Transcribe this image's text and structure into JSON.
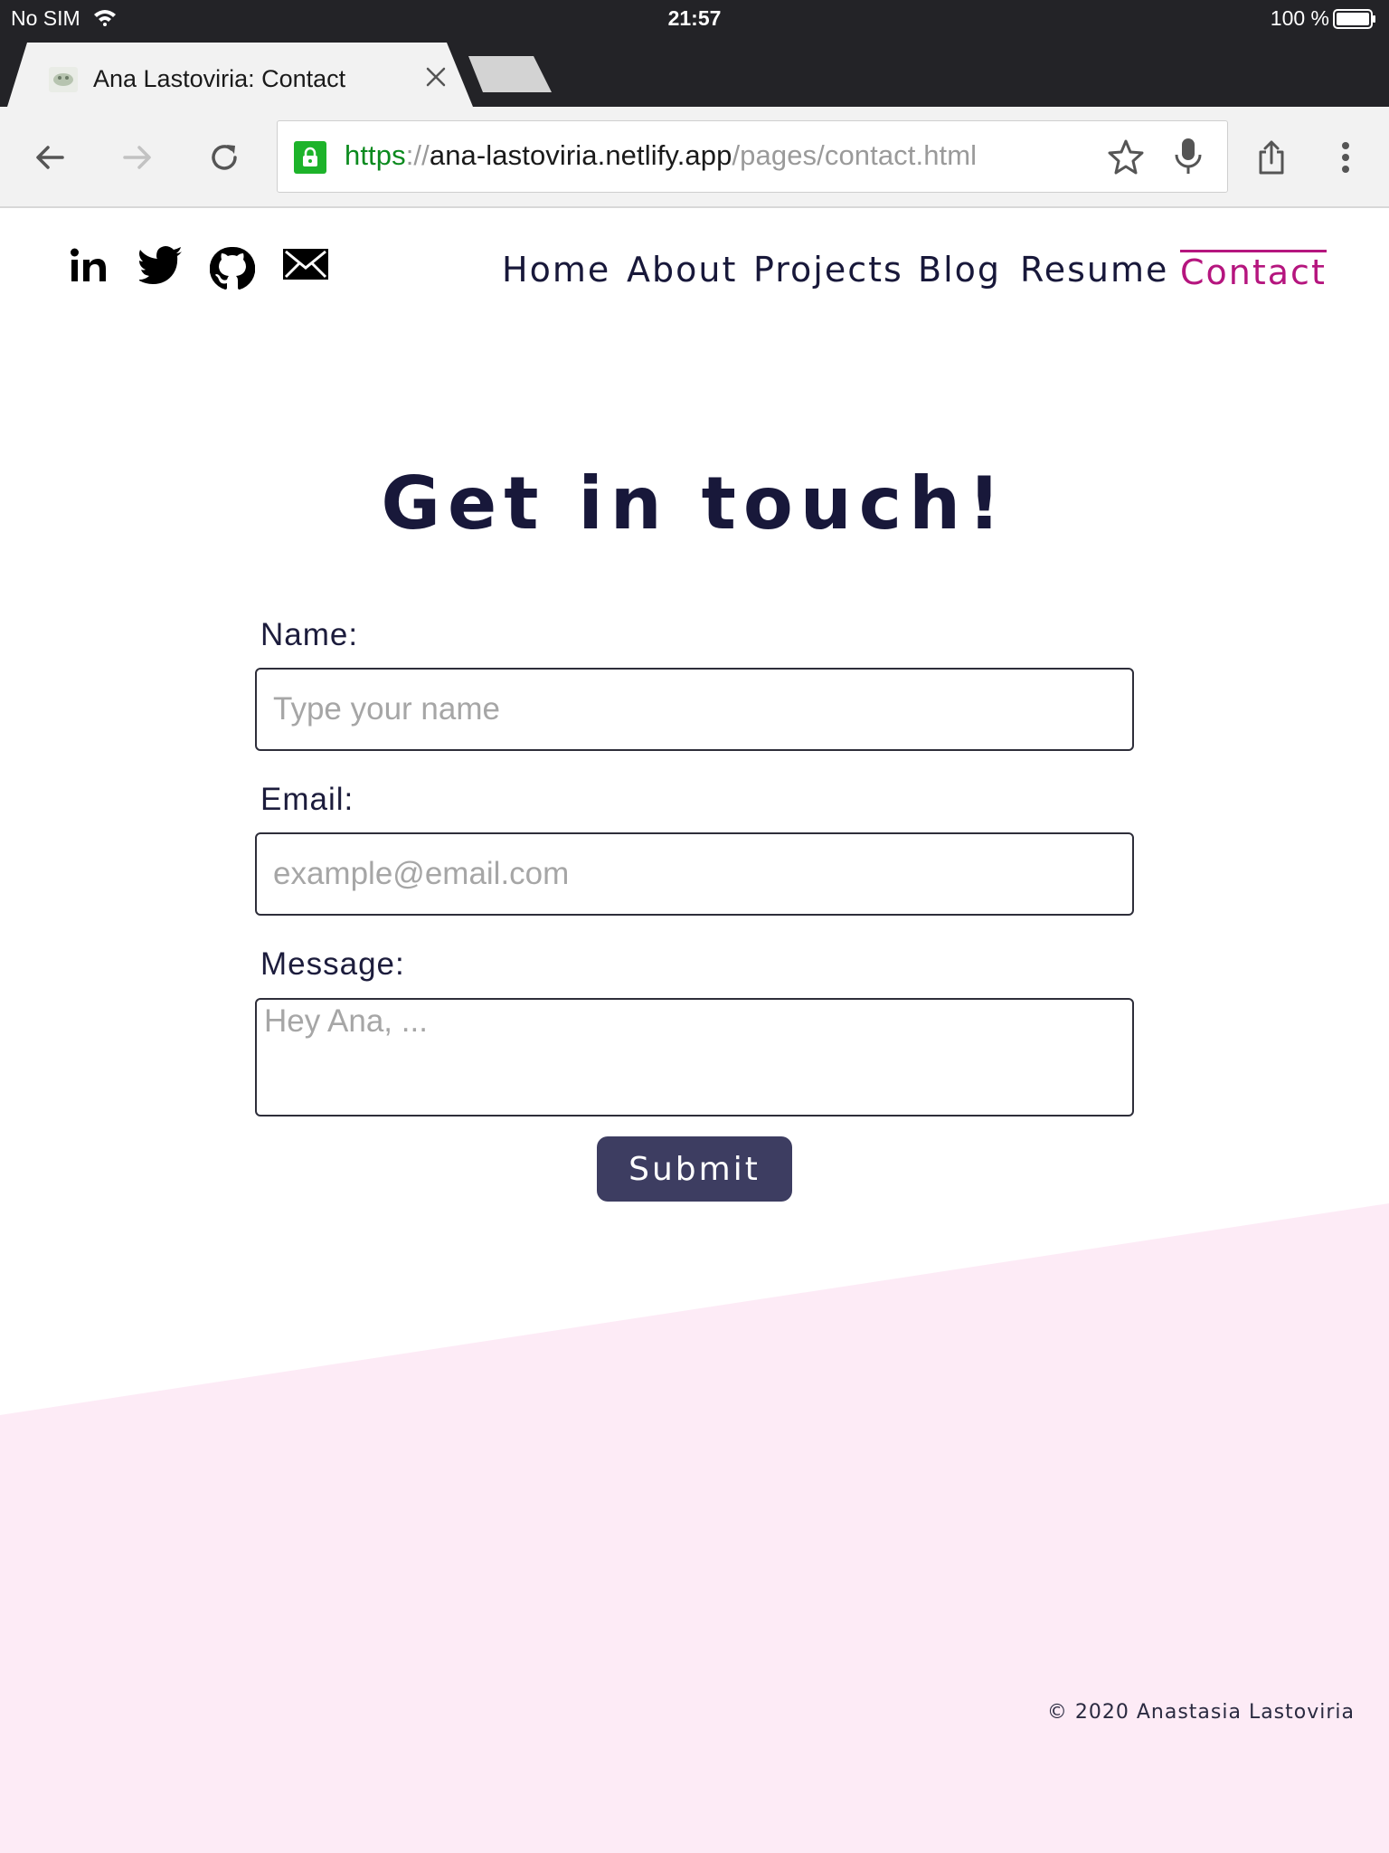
{
  "status_bar": {
    "carrier": "No SIM",
    "time": "21:57",
    "battery": "100 %"
  },
  "browser": {
    "tab_title": "Ana Lastoviria: Contact",
    "url": {
      "scheme": "https",
      "separator": "://",
      "host": "ana-lastoviria.netlify.app",
      "path": "/pages/contact.html"
    },
    "colors": {
      "chrome_dark": "#232327",
      "secure_green": "#1db32a"
    }
  },
  "site": {
    "social": [
      "linkedin-icon",
      "twitter-icon",
      "github-icon",
      "mail-icon"
    ],
    "nav": {
      "home": "Home",
      "about": "About",
      "projects": "Projects",
      "blog": "Blog",
      "resume": "Resume",
      "contact": "Contact"
    },
    "active_nav": "Contact",
    "accent_color": "#b5157e",
    "heading": "Get in touch!",
    "form": {
      "name_label": "Name:",
      "name_placeholder": "Type your name",
      "email_label": "Email:",
      "email_placeholder": "example@email.com",
      "message_label": "Message:",
      "message_placeholder": "Hey Ana, ...",
      "submit_label": "Submit"
    },
    "footer": "© 2020 Anastasia Lastoviria",
    "background_band_color": "#fdebf6"
  }
}
